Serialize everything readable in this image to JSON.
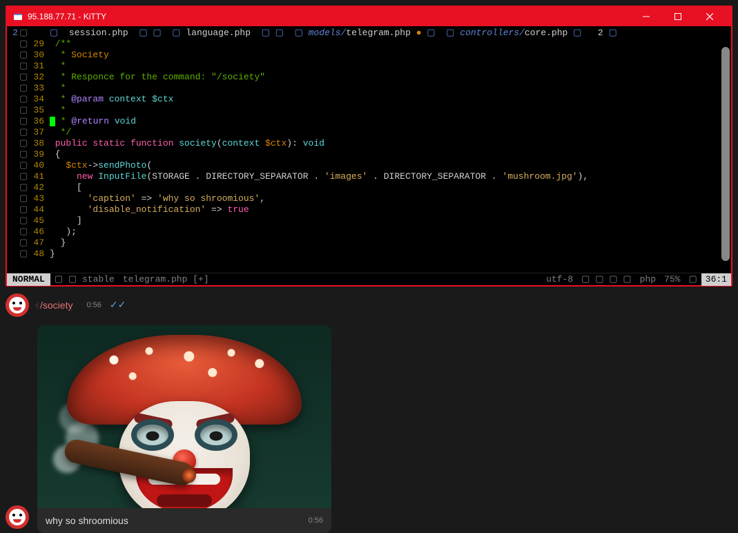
{
  "window": {
    "title": "95.188.77.71 - KiTTY"
  },
  "tabs": {
    "left_num": "2",
    "t1": "session.php",
    "t2": "language.php",
    "t3_dir": "models/",
    "t3_file": "telegram.php",
    "t4_dir": "controllers/",
    "t4_file": "core.php",
    "right_num": "2"
  },
  "lines": {
    "n29": "29",
    "n30": "30",
    "n31": "31",
    "n32": "32",
    "n33": "33",
    "n34": "34",
    "n35": "35",
    "n36": "36",
    "n37": "37",
    "n38": "38",
    "n39": "39",
    "n40": "40",
    "n41": "41",
    "n42": "42",
    "n43": "43",
    "n44": "44",
    "n45": "45",
    "n46": "46",
    "n47": "47",
    "n48": "48"
  },
  "code": {
    "l29": " /**",
    "l30a": "  * ",
    "l30b": "Society",
    "l31": "  *",
    "l32a": "  * ",
    "l32b": "Responce for the command: \"",
    "l32c": "/society",
    "l32d": "\"",
    "l33": "  *",
    "l34a": "  * ",
    "l34b": "@param",
    "l34c": " context ",
    "l34d": "$ctx",
    "l35": "  *",
    "l36a": " * ",
    "l36b": "@return",
    "l36c": " void",
    "l37": "  */",
    "l38a": " public static function ",
    "l38b": "society",
    "l38c": "(",
    "l38d": "context ",
    "l38e": "$ctx",
    "l38f": ")",
    "l38g": ": ",
    "l38h": "void",
    "l39": " {",
    "l40a": "   $ctx",
    "l40b": "->",
    "l40c": "sendPhoto",
    "l40d": "(",
    "l41a": "     new ",
    "l41b": "InputFile",
    "l41c": "(",
    "l41d": "STORAGE ",
    "l41e": ". ",
    "l41f": "DIRECTORY_SEPARATOR ",
    "l41g": ". ",
    "l41h": "'images' ",
    "l41i": ". ",
    "l41j": "DIRECTORY_SEPARATOR ",
    "l41k": ". ",
    "l41l": "'mushroom.jpg'",
    "l41m": "),",
    "l42": "     [",
    "l43a": "       'caption' ",
    "l43b": "=> ",
    "l43c": "'why so shroomious'",
    "l43d": ",",
    "l44a": "       'disable_notification' ",
    "l44b": "=> ",
    "l44c": "true",
    "l45": "     ]",
    "l46": "   );",
    "l47": "  }",
    "l48": "}"
  },
  "status": {
    "mode": "NORMAL",
    "branch": "stable",
    "file": "telegram.php [+]",
    "enc": "utf-8",
    "ft": "php",
    "pct": "75%",
    "pos": "36:1"
  },
  "chat": {
    "cmd": "/society",
    "time": "0:56",
    "caption": "why so shroomious",
    "caption_time": "0:56"
  }
}
